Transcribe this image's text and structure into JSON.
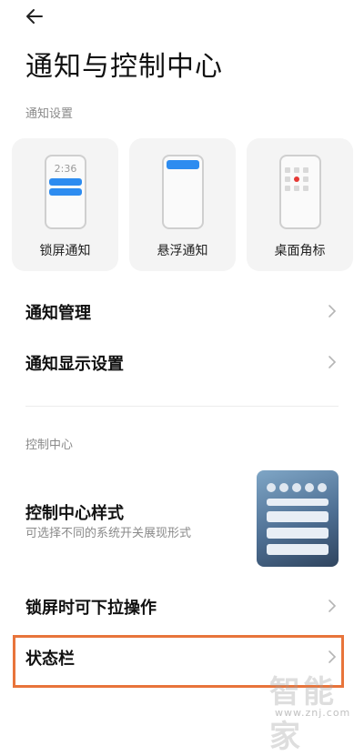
{
  "header": {
    "title": "通知与控制中心"
  },
  "notification_section": {
    "label": "通知设置",
    "cards": [
      {
        "label": "锁屏通知",
        "clock": "2:36"
      },
      {
        "label": "悬浮通知"
      },
      {
        "label": "桌面角标"
      }
    ],
    "items": [
      {
        "label": "通知管理"
      },
      {
        "label": "通知显示设置"
      }
    ]
  },
  "control_section": {
    "label": "控制中心",
    "style_item": {
      "title": "控制中心样式",
      "subtitle": "可选择不同的系统开关展现形式"
    },
    "items": [
      {
        "label": "锁屏时可下拉操作"
      },
      {
        "label": "状态栏"
      }
    ]
  },
  "watermark": {
    "text": "智能家",
    "url": "www.znj.com"
  },
  "colors": {
    "accent": "#2d8cf0",
    "highlight": "#e8743b",
    "badge": "#e53935"
  }
}
